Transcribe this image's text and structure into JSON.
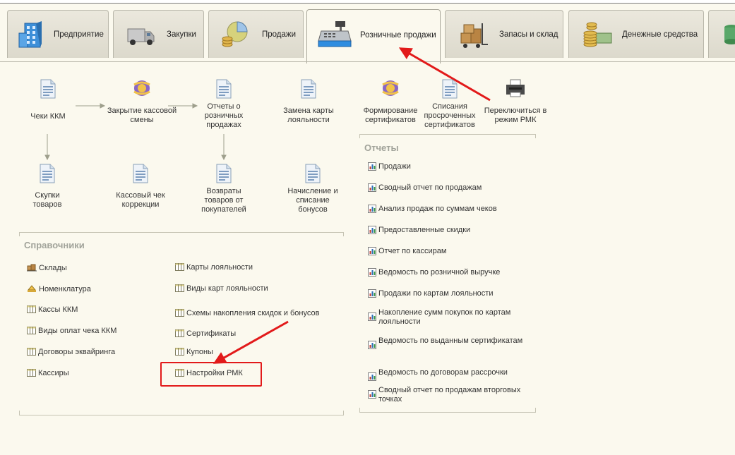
{
  "tabs": [
    {
      "label": "Предприятие",
      "icon": "building-icon"
    },
    {
      "label": "Закупки",
      "icon": "truck-icon"
    },
    {
      "label": "Продажи",
      "icon": "sales-pie-chart-icon"
    },
    {
      "label": "Розничные продажи",
      "icon": "cash-register-icon"
    },
    {
      "label": "Запасы и склад",
      "icon": "boxes-cart-icon"
    },
    {
      "label": "Денежные средства",
      "icon": "coins-icon"
    }
  ],
  "workspace": {
    "cheki": "Чеки ККМ",
    "zakrytie": "Закрытие кассовой смены",
    "otchety_rozn": "Отчеты о розничных продажах",
    "zamena_karty": "Замена карты лояльности",
    "skupki": "Скупки товаров",
    "chek_korrekcii": "Кассовый чек коррекции",
    "vozvraty": "Возвраты товаров от покупателей",
    "nachislenie": "Начисление и списание бонусов",
    "formirovanie": "Формирование сертификатов",
    "spisaniya": "Списания просроченных сертификатов",
    "pereklyuchitsya": "Переключиться в режим РМК"
  },
  "catalogs": {
    "title": "Справочники",
    "left": [
      "Склады",
      "Номенклатура",
      "Кассы ККМ",
      "Виды оплат чека ККМ",
      "Договоры эквайринга",
      "Кассиры"
    ],
    "right": [
      "Карты лояльности",
      "Виды карт лояльности",
      "Схемы накопления скидок и бонусов",
      "Сертификаты",
      "Купоны",
      "Настройки РМК"
    ]
  },
  "reports": {
    "title": "Отчеты",
    "items": [
      "Продажи",
      "Сводный отчет по продажам",
      "Анализ продаж по суммам чеков",
      "Предоставленные скидки",
      "Отчет по кассирам",
      "Ведомость по розничной выручке",
      "Продажи по картам лояльности",
      "Накопление сумм покупок по картам лояльности",
      "Ведомость по выданным сертификатам",
      "Ведомость по договорам рассрочки",
      "Сводный отчет по продажам вторговых точках"
    ]
  },
  "colors": {
    "annotation": "#e21a1a",
    "section_title": "#a1a39a",
    "background": "#fbf9ee"
  }
}
